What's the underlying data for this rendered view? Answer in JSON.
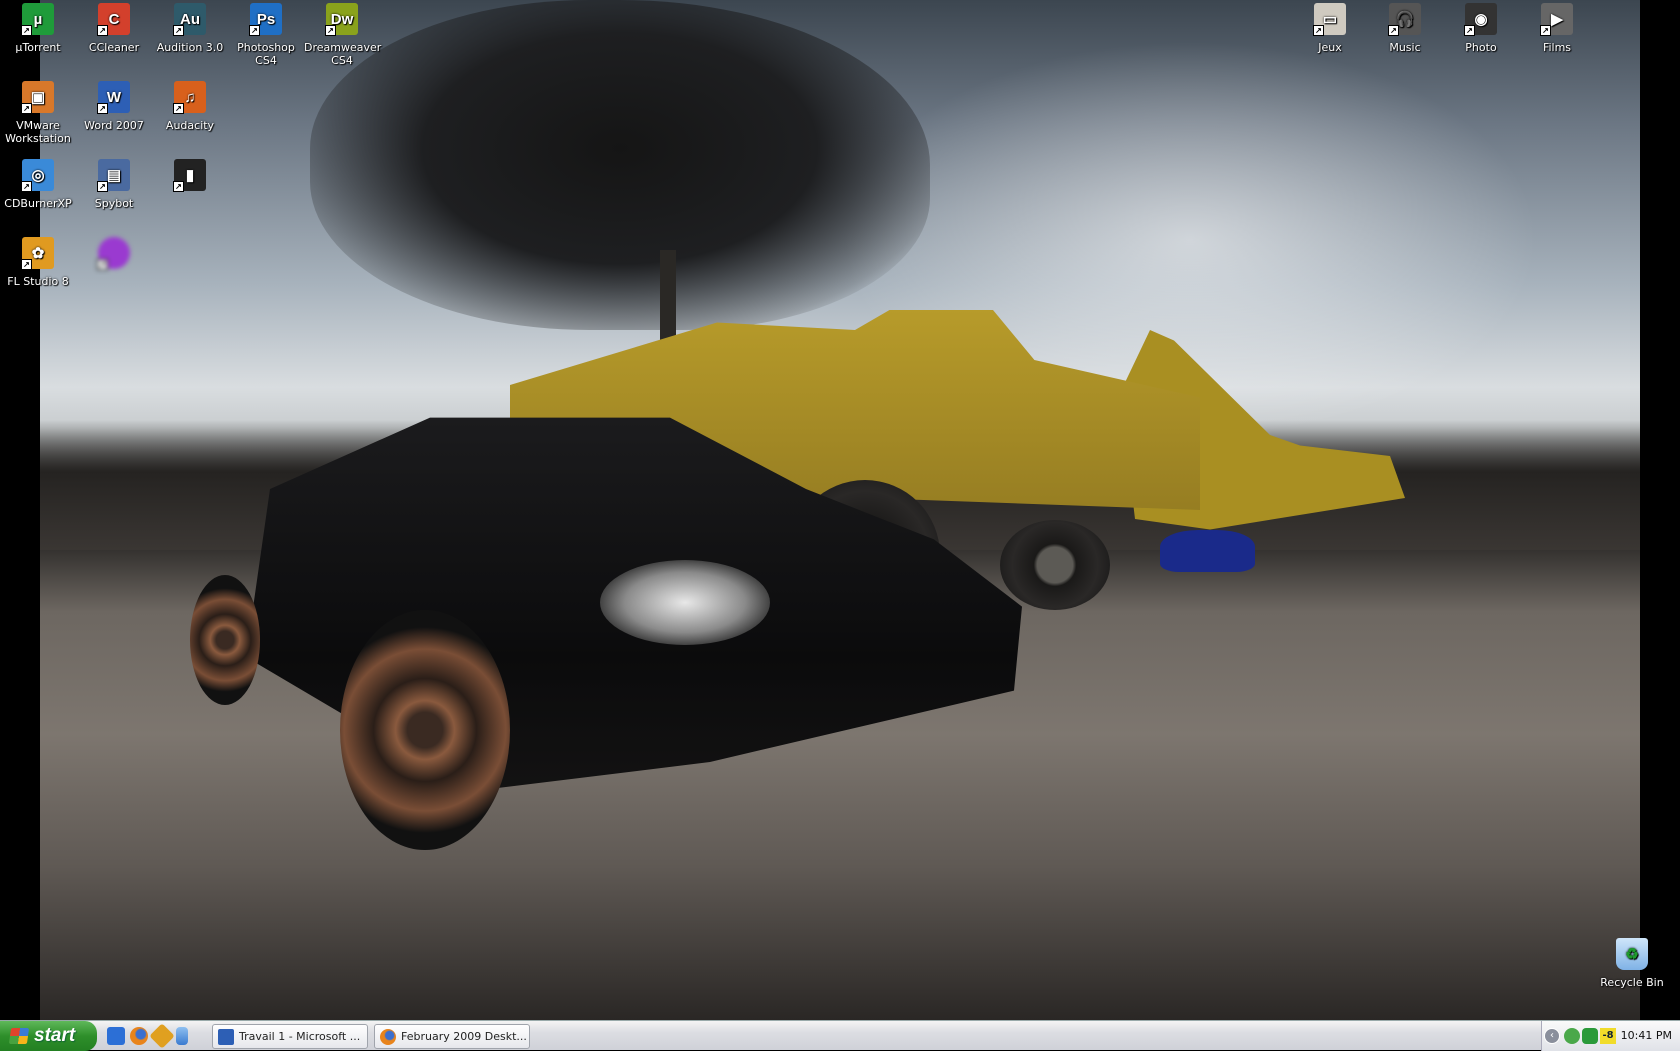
{
  "desktop": {
    "left_icons": [
      {
        "label": "µTorrent",
        "icon": "utorrent-icon",
        "glyph": "µ",
        "color": "#1f9b3a"
      },
      {
        "label": "CCleaner",
        "icon": "ccleaner-icon",
        "glyph": "C",
        "color": "#d3402c"
      },
      {
        "label": "Audition 3.0",
        "icon": "audition-icon",
        "glyph": "Au",
        "color": "#2e5a6a"
      },
      {
        "label": "Photoshop CS4",
        "icon": "photoshop-icon",
        "glyph": "Ps",
        "color": "#1f6fc5"
      },
      {
        "label": "Dreamweaver CS4",
        "icon": "dreamweaver-icon",
        "glyph": "Dw",
        "color": "#8aa21c"
      },
      {
        "label": "VMware Workstation",
        "icon": "vmware-icon",
        "glyph": "▣",
        "color": "#d8782a"
      },
      {
        "label": "Word 2007",
        "icon": "word-icon",
        "glyph": "W",
        "color": "#2d5fb5"
      },
      {
        "label": "Audacity",
        "icon": "audacity-icon",
        "glyph": "♫",
        "color": "#d8601c"
      },
      {
        "label": "CDBurnerXP",
        "icon": "cdburnerxp-icon",
        "glyph": "◎",
        "color": "#3a8ad8"
      },
      {
        "label": "Spybot",
        "icon": "spybot-icon",
        "glyph": "▤",
        "color": "#4a6aa0"
      },
      {
        "label": "",
        "icon": "equalizer-app-icon",
        "glyph": "▮",
        "color": "#222"
      },
      {
        "label": "FL Studio 8",
        "icon": "fl-studio-icon",
        "glyph": "✿",
        "color": "#e09a20"
      },
      {
        "label": "",
        "icon": "blurred-purple-app-icon",
        "glyph": "",
        "color": "#9a3ad0"
      }
    ],
    "right_icons": [
      {
        "label": "Jeux",
        "icon": "game-console-icon",
        "glyph": "▭",
        "color": "#cfcac0"
      },
      {
        "label": "Music",
        "icon": "headphones-icon",
        "glyph": "🎧",
        "color": "#555"
      },
      {
        "label": "Photo",
        "icon": "camera-icon",
        "glyph": "◉",
        "color": "#333"
      },
      {
        "label": "Films",
        "icon": "camcorder-icon",
        "glyph": "▶",
        "color": "#666"
      }
    ],
    "recycle_bin": {
      "label": "Recycle Bin"
    }
  },
  "taskbar": {
    "start_label": "start",
    "quick_launch": [
      "show-desktop-icon",
      "firefox-icon",
      "winamp-icon",
      "messenger-icon"
    ],
    "tasks": [
      {
        "label": "Travail 1 - Microsoft ...",
        "icon": "word-icon"
      },
      {
        "label": "February 2009 Deskt...",
        "icon": "firefox-icon"
      }
    ],
    "tray": {
      "badge": "-8",
      "clock": "10:41 PM"
    }
  }
}
